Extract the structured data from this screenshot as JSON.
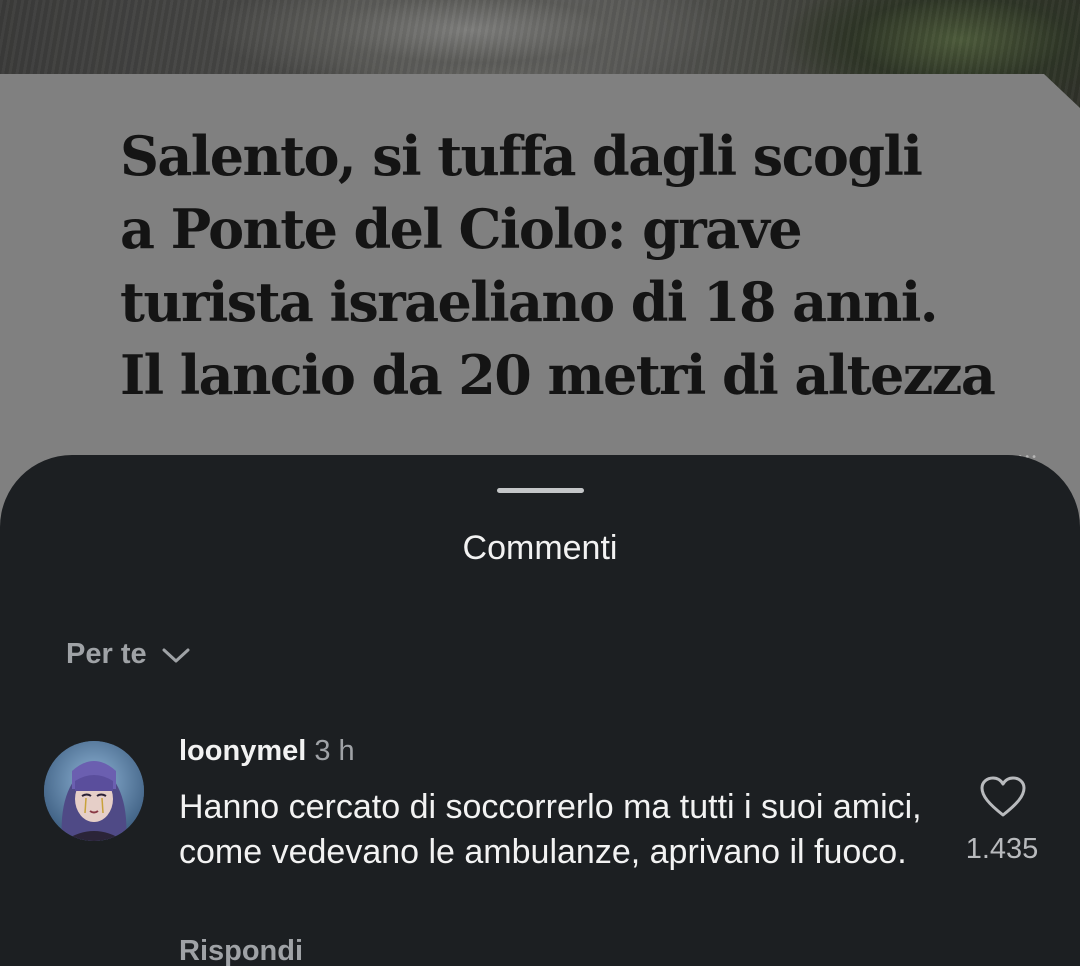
{
  "post": {
    "headline_lines": [
      "Salento, si tuffa dagli scogli",
      "a Ponte del Ciolo: grave",
      "turista israeliano di 18 anni.",
      "Il lancio da 20 metri di altezza"
    ],
    "more_icon": "ellipsis-icon"
  },
  "sheet": {
    "title": "Commenti",
    "sort_label": "Per te",
    "sort_icon": "chevron-down-icon"
  },
  "comments": [
    {
      "username": "loonymel",
      "time": "3 h",
      "text": "Hanno cercato di soccorrerlo ma tutti i suoi amici, come vedevano le ambulanze, aprivano il fuoco.",
      "likes": "1.435",
      "reply_label": "Rispondi",
      "like_icon": "heart-icon"
    }
  ],
  "colors": {
    "sheet_bg": "#1c1f22",
    "overlay_card": "#808080",
    "primary_text": "#f2f2f2",
    "secondary_text": "#9fa2a6"
  }
}
